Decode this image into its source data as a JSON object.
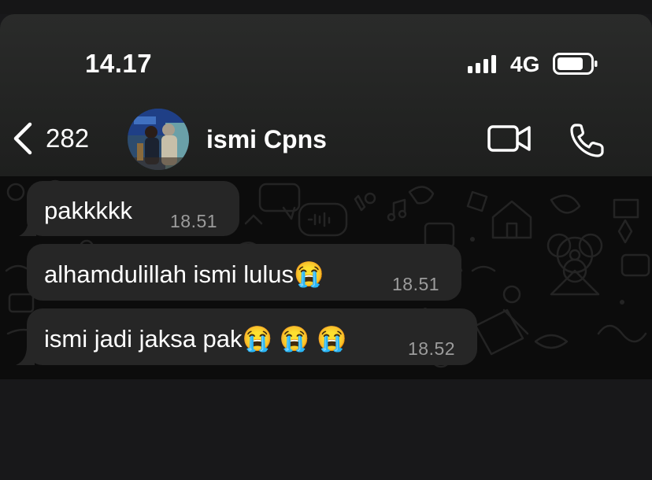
{
  "status_bar": {
    "time": "14.17",
    "network": "4G",
    "signal_bars_filled": 4,
    "battery_level": 0.8
  },
  "chat_header": {
    "back_count": "282",
    "contact_name": "ismi Cpns",
    "icons": {
      "back": "chevron-left-icon",
      "video": "video-camera-icon",
      "call": "phone-icon"
    }
  },
  "messages": [
    {
      "text": "pakkkkk",
      "time": "18.51"
    },
    {
      "text": "alhamdulillah ismi lulus😭",
      "time": "18.51"
    },
    {
      "text": "ismi jadi jaksa pak😭 😭 😭",
      "time": "18.52"
    }
  ],
  "colors": {
    "header_bg": "#252625",
    "chat_bg": "#0c0c0c",
    "bubble_bg": "#262626",
    "text": "#ffffff",
    "timestamp": "#9c9c9c"
  }
}
